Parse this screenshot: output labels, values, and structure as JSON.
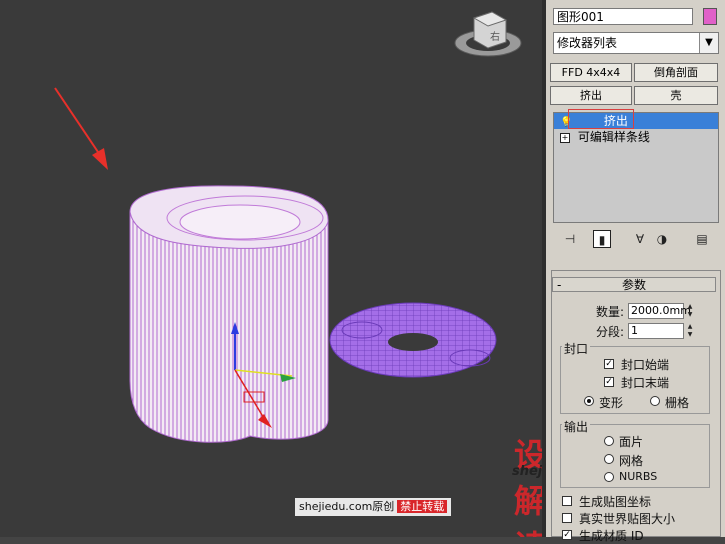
{
  "viewport": {
    "viewcube_label": "右",
    "arrow_color": "#e8302a"
  },
  "panel": {
    "object_name": "图形001",
    "object_color": "#e060c8",
    "modifier_list": "修改器列表",
    "buttons": {
      "ffd": "FFD 4x4x4",
      "bevel_profile": "倒角剖面",
      "extrude": "挤出",
      "shell": "壳"
    },
    "stack": {
      "items": [
        {
          "label": "挤出",
          "selected": true
        },
        {
          "label": "可编辑样条线",
          "selected": false
        }
      ]
    },
    "params": {
      "title": "参数",
      "amount_label": "数量:",
      "amount_value": "2000.0mm",
      "segments_label": "分段:",
      "segments_value": "1",
      "capping_label": "封口",
      "cap_start": "封口始端",
      "cap_end": "封口末端",
      "morph": "变形",
      "grid": "栅格",
      "output_label": "输出",
      "output_patch": "面片",
      "output_mesh": "网格",
      "output_nurbs": "NURBS",
      "gen_map_coords": "生成贴图坐标",
      "real_world_map": "真实世界贴图大小",
      "gen_mat_id": "生成材质 ID"
    }
  },
  "watermark": {
    "brand": "设解读",
    "url": "shejiedu.com",
    "footer_src": "shejiedu.com原创",
    "footer_forbid": "禁止转载"
  }
}
